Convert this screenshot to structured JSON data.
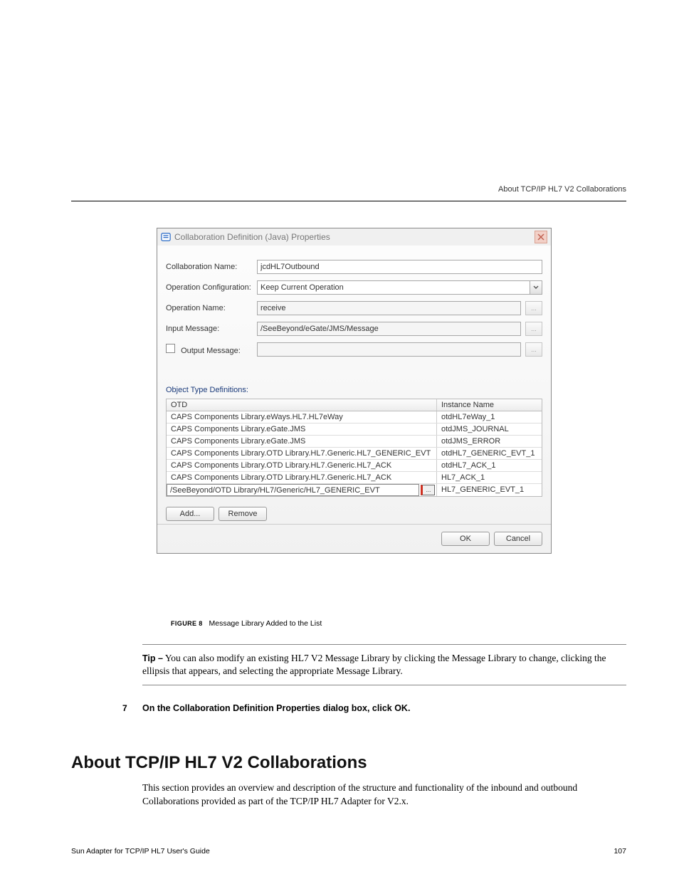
{
  "header": {
    "section_title": "About TCP/IP HL7 V2 Collaborations"
  },
  "dialog": {
    "title": "Collaboration Definition (Java) Properties",
    "fields": {
      "collab_name_label": "Collaboration Name:",
      "collab_name_value": "jcdHL7Outbound",
      "op_config_label": "Operation Configuration:",
      "op_config_value": "Keep Current Operation",
      "op_name_label": "Operation Name:",
      "op_name_value": "receive",
      "input_msg_label": "Input Message:",
      "input_msg_value": "/SeeBeyond/eGate/JMS/Message",
      "output_msg_label": "Output Message:",
      "output_msg_value": ""
    },
    "otd_section_label": "Object Type Definitions:",
    "table": {
      "col1": "OTD",
      "col2": "Instance Name",
      "rows": [
        {
          "otd": "CAPS Components Library.eWays.HL7.HL7eWay",
          "instance": "otdHL7eWay_1"
        },
        {
          "otd": "CAPS Components Library.eGate.JMS",
          "instance": "otdJMS_JOURNAL"
        },
        {
          "otd": "CAPS Components Library.eGate.JMS",
          "instance": "otdJMS_ERROR"
        },
        {
          "otd": "CAPS Components Library.OTD Library.HL7.Generic.HL7_GENERIC_EVT",
          "instance": "otdHL7_GENERIC_EVT_1"
        },
        {
          "otd": "CAPS Components Library.OTD Library.HL7.Generic.HL7_ACK",
          "instance": "otdHL7_ACK_1"
        },
        {
          "otd": "CAPS Components Library.OTD Library.HL7.Generic.HL7_ACK",
          "instance": "HL7_ACK_1"
        },
        {
          "otd": "/SeeBeyond/OTD Library/HL7/Generic/HL7_GENERIC_EVT",
          "instance": "HL7_GENERIC_EVT_1"
        }
      ]
    },
    "buttons": {
      "add": "Add...",
      "remove": "Remove",
      "ok": "OK",
      "cancel": "Cancel"
    },
    "ellipsis": "..."
  },
  "doc": {
    "figure_label": "FIGURE 8",
    "figure_caption": "Message Library Added to the List",
    "tip_label": "Tip –",
    "tip_text": "You can also modify an existing HL7 V2 Message Library by clicking the Message Library to change, clicking the ellipsis that appears, and selecting the appropriate Message Library.",
    "step_num": "7",
    "step_text": "On the Collaboration Definition Properties dialog box, click OK.",
    "heading": "About TCP/IP HL7 V2 Collaborations",
    "paragraph": "This section provides an overview and description of the structure and functionality of the inbound and outbound Collaborations provided as part of the TCP/IP HL7 Adapter for V2.x.",
    "footer_left": "Sun Adapter for TCP/IP HL7 User's Guide",
    "footer_right": "107"
  }
}
